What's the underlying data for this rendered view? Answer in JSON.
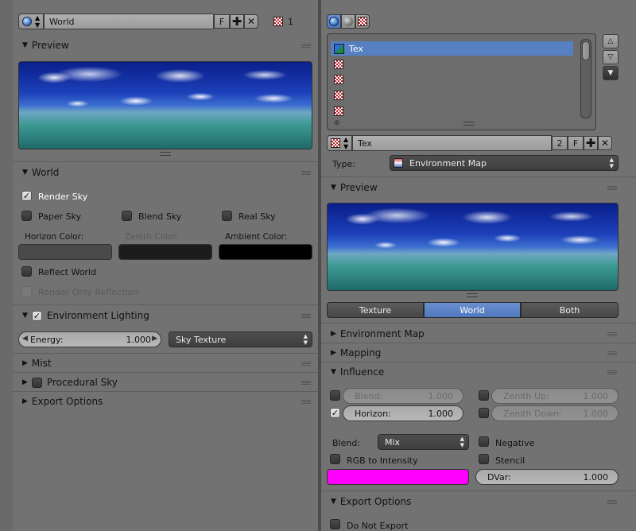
{
  "left": {
    "world_selector": {
      "name": "World",
      "fake_user": "F",
      "user_count": "1"
    },
    "preview_panel": {
      "title": "Preview"
    },
    "world_panel": {
      "title": "World",
      "render_sky": "Render Sky",
      "paper_sky": "Paper Sky",
      "blend_sky": "Blend Sky",
      "real_sky": "Real Sky",
      "horizon_color_label": "Horizon Color:",
      "zenith_color_label": "Zenith Color:",
      "ambient_color_label": "Ambient Color:",
      "horizon_color": "#4a4a4a",
      "zenith_color": "#1c1c1c",
      "ambient_color": "#000000",
      "reflect_world": "Reflect World",
      "render_only_reflection": "Render Only Reflection"
    },
    "env_lighting": {
      "title": "Environment Lighting",
      "energy_label": "Energy:",
      "energy_value": "1.000",
      "source": "Sky Texture"
    },
    "mist": {
      "title": "Mist"
    },
    "procedural_sky": {
      "title": "Procedural Sky"
    },
    "export_options": {
      "title": "Export Options"
    }
  },
  "right": {
    "texture_list": [
      "Tex",
      "",
      "",
      "",
      ""
    ],
    "texture_selector": {
      "name": "Tex",
      "user_count": "2",
      "fake_user": "F"
    },
    "type": {
      "label": "Type:",
      "value": "Environment Map"
    },
    "preview_panel": {
      "title": "Preview"
    },
    "preview_modes": [
      "Texture",
      "World",
      "Both"
    ],
    "preview_active": "World",
    "environment_map": {
      "title": "Environment Map"
    },
    "mapping": {
      "title": "Mapping"
    },
    "influence": {
      "title": "Influence",
      "blend_label": "Blend:",
      "blend_value": "1.000",
      "zenith_up_label": "Zenith Up:",
      "zenith_up_value": "1.000",
      "horizon_label": "Horizon:",
      "horizon_value": "1.000",
      "zenith_down_label": "Zenith Down:",
      "zenith_down_value": "1.000",
      "blend_mode_label": "Blend:",
      "blend_mode_value": "Mix",
      "negative": "Negative",
      "rgb_to_intensity": "RGB to Intensity",
      "stencil": "Stencil",
      "color": "#ff00ff",
      "dvar_label": "DVar:",
      "dvar_value": "1.000"
    },
    "export_options": {
      "title": "Export Options",
      "do_not_export": "Do Not Export"
    }
  }
}
